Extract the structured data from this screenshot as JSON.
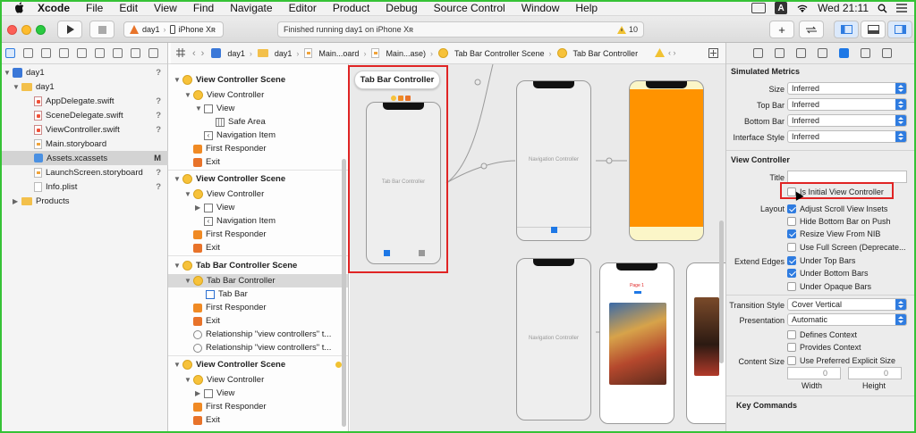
{
  "menubar": {
    "app": "Xcode",
    "items": [
      "File",
      "Edit",
      "View",
      "Find",
      "Navigate",
      "Editor",
      "Product",
      "Debug",
      "Source Control",
      "Window",
      "Help"
    ],
    "input_badge": "A",
    "clock": "Wed 21:11"
  },
  "toolbar": {
    "scheme_target": "day1",
    "scheme_device": "iPhone Xʀ",
    "status": "Finished running day1 on iPhone Xʀ",
    "warning_count": "10"
  },
  "navigator": {
    "project": "day1",
    "group": "day1",
    "files": [
      {
        "name": "AppDelegate.swift",
        "badge": "?"
      },
      {
        "name": "SceneDelegate.swift",
        "badge": "?"
      },
      {
        "name": "ViewController.swift",
        "badge": "?"
      },
      {
        "name": "Main.storyboard",
        "badge": ""
      },
      {
        "name": "Assets.xcassets",
        "badge": "M"
      },
      {
        "name": "LaunchScreen.storyboard",
        "badge": "?"
      },
      {
        "name": "Info.plist",
        "badge": "?"
      }
    ],
    "products": "Products"
  },
  "outline": {
    "scene1": {
      "title": "View Controller Scene",
      "vc": "View Controller",
      "view": "View",
      "safe": "Safe Area",
      "navitem": "Navigation Item",
      "fr": "First Responder",
      "exit": "Exit"
    },
    "scene2": {
      "title": "View Controller Scene",
      "vc": "View Controller",
      "view": "View",
      "navitem": "Navigation Item",
      "fr": "First Responder",
      "exit": "Exit"
    },
    "scene3": {
      "title": "Tab Bar Controller Scene",
      "tbc": "Tab Bar Controller",
      "tabbar": "Tab Bar",
      "fr": "First Responder",
      "exit": "Exit",
      "rel1": "Relationship \"view controllers\" t...",
      "rel2": "Relationship \"view controllers\" t..."
    },
    "scene4": {
      "title": "View Controller Scene",
      "vc": "View Controller",
      "view": "View",
      "fr": "First Responder",
      "exit": "Exit"
    }
  },
  "breadcrumb": [
    "day1",
    "day1",
    "Main...oard",
    "Main...ase)",
    "Tab Bar Controller Scene",
    "Tab Bar Controller"
  ],
  "canvas": {
    "scene_title": "Tab Bar Controller",
    "tbc_label": "Tab Bar Controller",
    "nav_label_1": "Navigation Controller",
    "nav_label_2": "Navigation Controller",
    "page_label": "Page 1",
    "colors": {
      "orange_view": "#ff9300",
      "highlight": "#e02424"
    }
  },
  "inspector": {
    "simulated_metrics": "Simulated Metrics",
    "size_label": "Size",
    "size_value": "Inferred",
    "topbar_label": "Top Bar",
    "topbar_value": "Inferred",
    "bottombar_label": "Bottom Bar",
    "bottombar_value": "Inferred",
    "interface_label": "Interface Style",
    "interface_value": "Inferred",
    "vc_section": "View Controller",
    "title_label": "Title",
    "initial_vc": "Is Initial View Controller",
    "layout_label": "Layout",
    "adjust_scroll": "Adjust Scroll View Insets",
    "hide_bottom": "Hide Bottom Bar on Push",
    "resize_nib": "Resize View From NIB",
    "full_screen": "Use Full Screen (Deprecate...",
    "extend_label": "Extend Edges",
    "under_top": "Under Top Bars",
    "under_bottom": "Under Bottom Bars",
    "under_opaque": "Under Opaque Bars",
    "transition_label": "Transition Style",
    "transition_value": "Cover Vertical",
    "presentation_label": "Presentation",
    "presentation_value": "Automatic",
    "defines_context": "Defines Context",
    "provides_context": "Provides Context",
    "content_size_label": "Content Size",
    "preferred_explicit": "Use Preferred Explicit Size",
    "width_label": "Width",
    "height_label": "Height",
    "width_value": "0",
    "height_value": "0",
    "key_commands": "Key Commands"
  }
}
